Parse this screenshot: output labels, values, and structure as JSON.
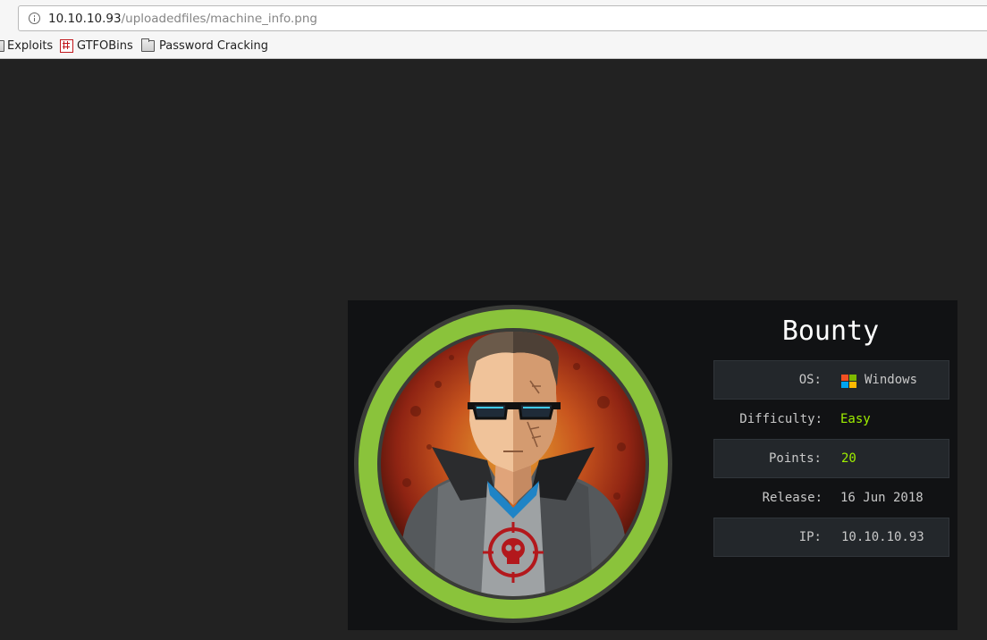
{
  "browser": {
    "url_host": "10.10.10.93",
    "url_path": "/uploadedfiles/machine_info.png",
    "bookmarks": [
      {
        "label": "Exploits",
        "icon": "folder-icon"
      },
      {
        "label": "GTFOBins",
        "icon": "gtfobins-icon"
      },
      {
        "label": "Password Cracking",
        "icon": "folder-icon"
      }
    ]
  },
  "machine": {
    "name": "Bounty",
    "os_label": "OS:",
    "os": "Windows",
    "difficulty_label": "Difficulty:",
    "difficulty": "Easy",
    "points_label": "Points:",
    "points": "20",
    "release_label": "Release:",
    "release": "16 Jun 2018",
    "ip_label": "IP:",
    "ip": "10.10.10.93",
    "avatar_ring_color": "#8ac33b",
    "value_highlight_color": "#9fef00"
  }
}
